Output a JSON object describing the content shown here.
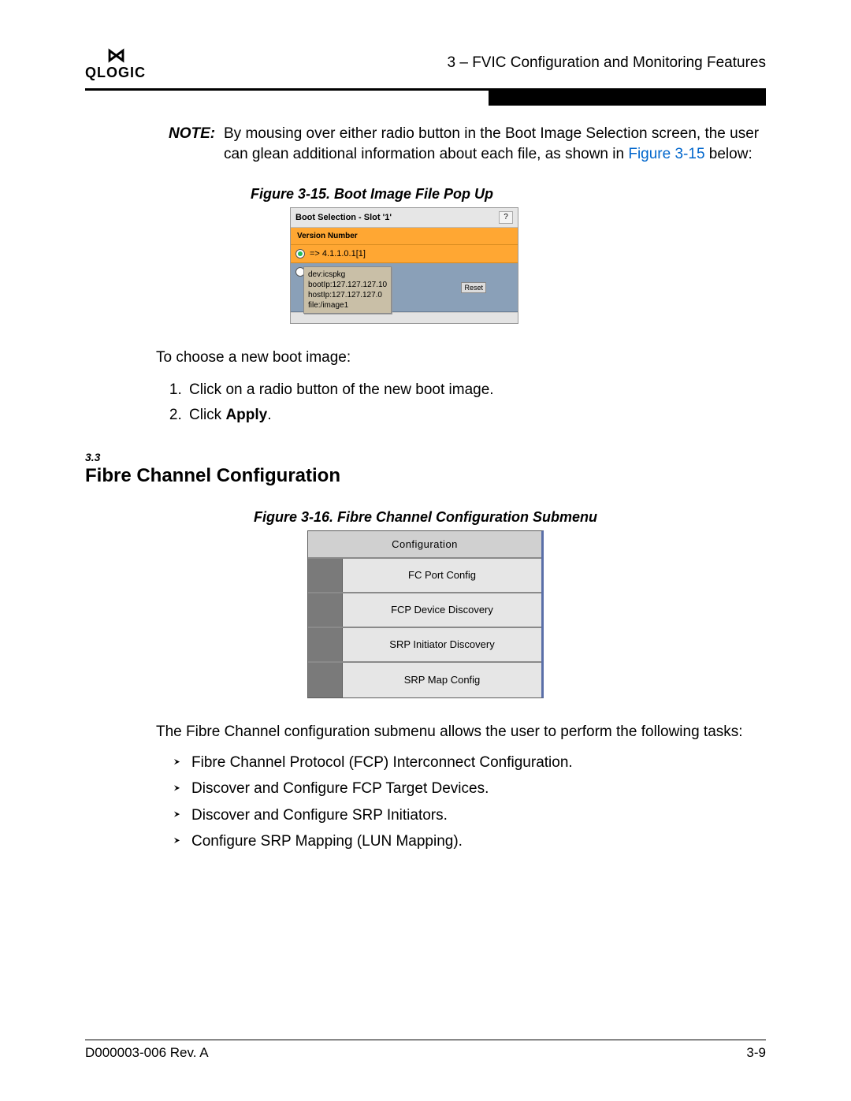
{
  "header": {
    "logo_chars": "⋈",
    "logo_text": "QLOGIC",
    "chapter_title": "3 – FVIC Configuration and Monitoring Features"
  },
  "note": {
    "label": "NOTE:",
    "body_part_a": "By mousing over either radio button in the Boot Image Selection screen, the user can glean additional information about each file, as shown in ",
    "link": "Figure 3-15",
    "body_part_b": " below:"
  },
  "fig315": {
    "caption": "Figure 3-15. Boot Image File Pop Up",
    "top_title": "Boot Selection - Slot '1'",
    "help": "?",
    "version_header": "Version Number",
    "selected_label": "=> 4.1.1.0.1[1]",
    "tooltip": {
      "line1": "dev:icspkg",
      "line2": "bootIp:127.127.127.10",
      "line3": "hostIp:127.127.127.0",
      "line4": "file:/image1"
    },
    "reset_label": "Reset"
  },
  "choose_para": "To choose a new boot image:",
  "steps": {
    "s1": "Click on a radio button of the new boot image.",
    "s2_a": "Click ",
    "s2_b": "Apply",
    "s2_c": "."
  },
  "section": {
    "num": "3.3",
    "title": "Fibre Channel Configuration"
  },
  "fig316": {
    "caption": "Figure 3-16. Fibre Channel Configuration Submenu",
    "head": "Configuration",
    "items": [
      "FC Port Config",
      "FCP Device Discovery",
      "SRP Initiator Discovery",
      "SRP Map Config"
    ]
  },
  "submenu_para": "The Fibre Channel configuration submenu allows the user to perform the following tasks:",
  "tasks": [
    "Fibre Channel Protocol (FCP) Interconnect Configuration.",
    "Discover and Configure FCP Target Devices.",
    "Discover and Configure SRP Initiators.",
    "Configure SRP Mapping (LUN Mapping)."
  ],
  "footer": {
    "doc": "D000003-006 Rev. A",
    "page": "3-9"
  }
}
